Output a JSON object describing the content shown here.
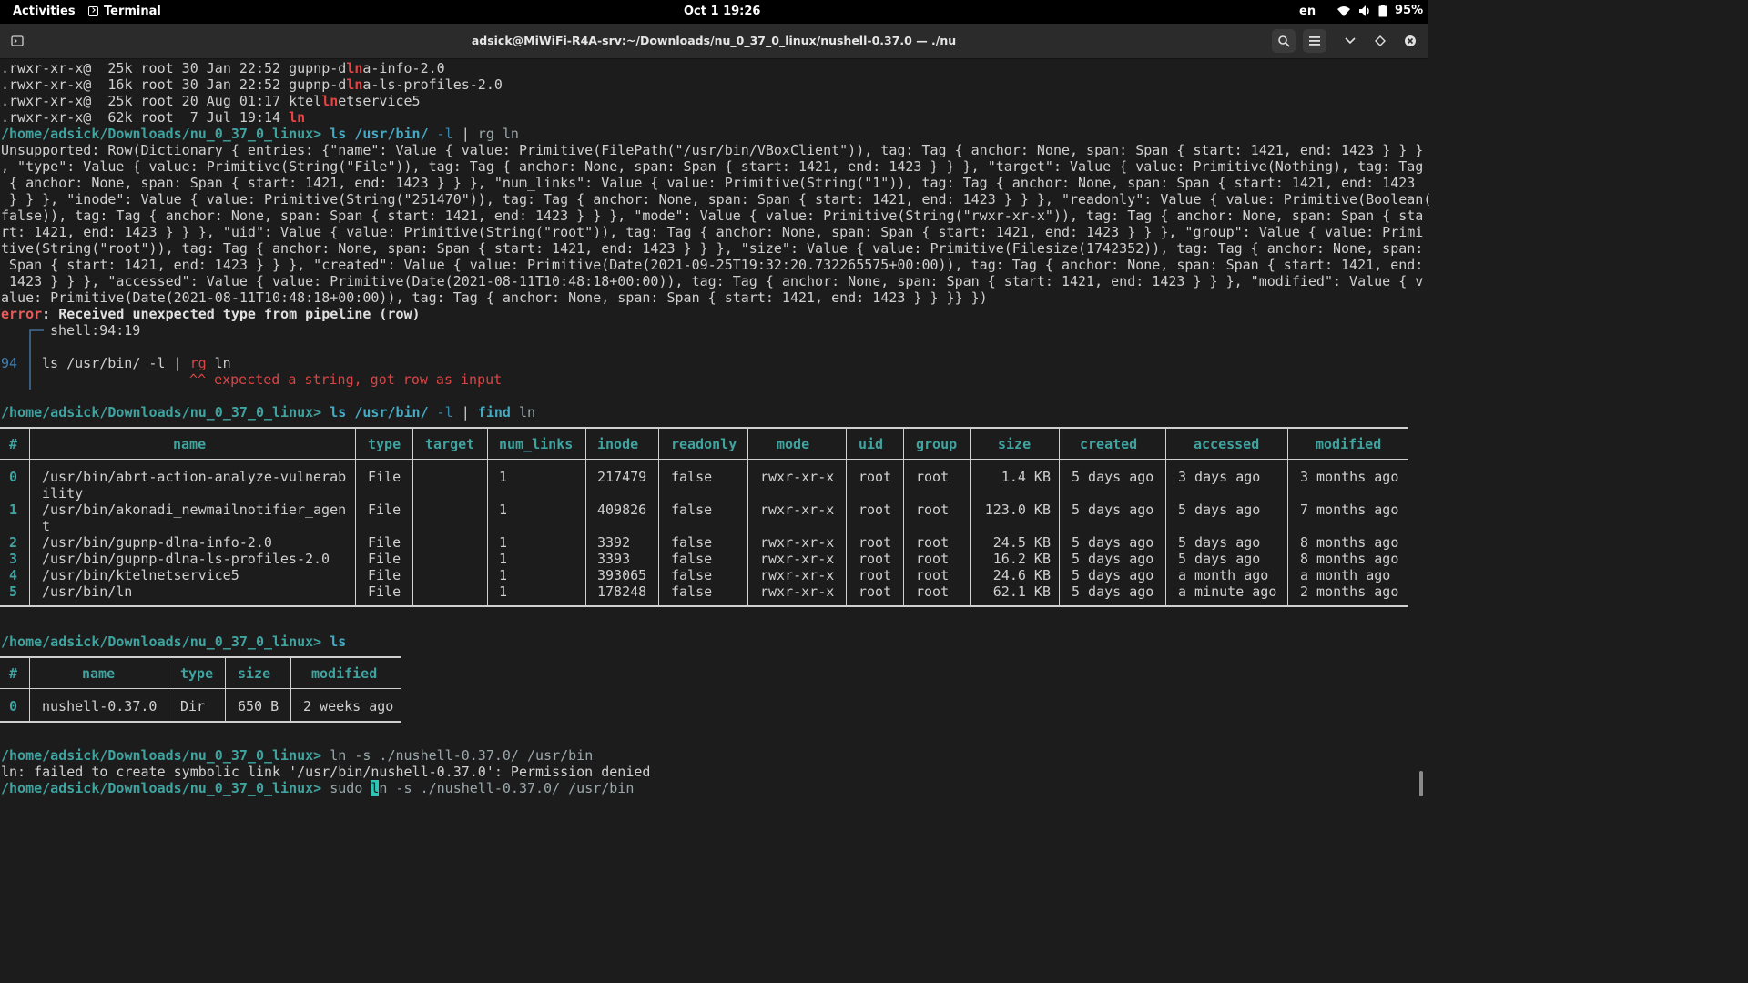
{
  "topbar": {
    "activities": "Activities",
    "app_name": "Terminal",
    "clock": "Oct 1  19:26",
    "lang": "en",
    "battery": "95%"
  },
  "window": {
    "title": "adsick@MiWiFi-R4A-srv:~/Downloads/nu_0_37_0_linux/nushell-0.37.0 — ./nu"
  },
  "terminal": {
    "prompt": "/home/adsick/Downloads/nu_0_37_0_linux>",
    "ls_lines": [
      {
        "perm": ".rwxr-xr-x@",
        "info": "  25k root 30 Jan 22:52 ",
        "pre": "gupnp-d",
        "hl": "ln",
        "post": "a-info-2.0"
      },
      {
        "perm": ".rwxr-xr-x@",
        "info": "  16k root 30 Jan 22:52 ",
        "pre": "gupnp-d",
        "hl": "ln",
        "post": "a-ls-profiles-2.0"
      },
      {
        "perm": ".rwxr-xr-x@",
        "info": "  25k root 20 Aug 01:17 ",
        "pre": "ktel",
        "hl": "ln",
        "post": "etservice5"
      },
      {
        "perm": ".rwxr-xr-x@",
        "info": "  62k root  7 Jul 19:14 ",
        "pre": "",
        "hl": "ln",
        "post": ""
      }
    ],
    "cmd1": {
      "c": "ls",
      "a": "/usr/bin/",
      "f": "-l",
      "p": "|",
      "c2": "rg",
      "a2": "ln"
    },
    "unsupported": [
      "Unsupported: Row(Dictionary { entries: {\"name\": Value { value: Primitive(FilePath(\"/usr/bin/VBoxClient\")), tag: Tag { anchor: None, span: Span { start: 1421, end: 1423 } } }",
      ", \"type\": Value { value: Primitive(String(\"File\")), tag: Tag { anchor: None, span: Span { start: 1421, end: 1423 } } }, \"target\": Value { value: Primitive(Nothing), tag: Tag",
      " { anchor: None, span: Span { start: 1421, end: 1423 } } }, \"num_links\": Value { value: Primitive(String(\"1\")), tag: Tag { anchor: None, span: Span { start: 1421, end: 1423",
      " } } }, \"inode\": Value { value: Primitive(String(\"251470\")), tag: Tag { anchor: None, span: Span { start: 1421, end: 1423 } } }, \"readonly\": Value { value: Primitive(Boolean(",
      "false)), tag: Tag { anchor: None, span: Span { start: 1421, end: 1423 } } }, \"mode\": Value { value: Primitive(String(\"rwxr-xr-x\")), tag: Tag { anchor: None, span: Span { sta",
      "rt: 1421, end: 1423 } } }, \"uid\": Value { value: Primitive(String(\"root\")), tag: Tag { anchor: None, span: Span { start: 1421, end: 1423 } } }, \"group\": Value { value: Primi",
      "tive(String(\"root\")), tag: Tag { anchor: None, span: Span { start: 1421, end: 1423 } } }, \"size\": Value { value: Primitive(Filesize(1742352)), tag: Tag { anchor: None, span:",
      " Span { start: 1421, end: 1423 } } }, \"created\": Value { value: Primitive(Date(2021-09-25T19:32:20.732265575+00:00)), tag: Tag { anchor: None, span: Span { start: 1421, end:",
      " 1423 } } }, \"accessed\": Value { value: Primitive(Date(2021-08-11T10:48:18+00:00)), tag: Tag { anchor: None, span: Span { start: 1421, end: 1423 } } }, \"modified\": Value { v",
      "alue: Primitive(Date(2021-08-11T10:48:18+00:00)), tag: Tag { anchor: None, span: Span { start: 1421, end: 1423 } } }} })"
    ],
    "error": {
      "label": "error",
      "message": ": Received unexpected type from pipeline (row)",
      "location": "shell:94:19",
      "line_no": "94",
      "src_pre": "ls /usr/bin/ -l | ",
      "src_hl": "rg",
      "src_post": " ln",
      "caret": "^^ expected a string, got row as input"
    },
    "cmd2": {
      "c": "ls",
      "a": "/usr/bin/",
      "f": "-l",
      "p": "|",
      "c2": "find",
      "a2": "ln"
    },
    "cmd3": {
      "c": "ls"
    },
    "cmd4": {
      "c": "ln -s ./nushell-0.37.0/ /usr/bin"
    },
    "ln_error": "ln: failed to create symbolic link '/usr/bin/nushell-0.37.0': Permission denied",
    "cmd5": {
      "pre": "sudo ",
      "cursor": "l",
      "post": "n -s ./nushell-0.37.0/ /usr/bin"
    }
  },
  "table1": {
    "headers": [
      "#",
      "name",
      "type",
      "target",
      "num_links",
      "inode",
      "readonly",
      "mode",
      "uid",
      "group",
      "size",
      "created",
      "accessed",
      "modified"
    ],
    "rows": [
      {
        "idx": "0",
        "name": "/usr/bin/abrt-action-analyze-vulnerab",
        "name2": "ility",
        "type": "File",
        "target": "",
        "num_links": "1",
        "inode": "217479",
        "readonly": "false",
        "mode": "rwxr-xr-x",
        "uid": "root",
        "group": "root",
        "size": "1.4 KB",
        "created": "5 days ago",
        "accessed": "3 days ago",
        "modified": "3 months ago"
      },
      {
        "idx": "1",
        "name": "/usr/bin/akonadi_newmailnotifier_agen",
        "name2": "t",
        "type": "File",
        "target": "",
        "num_links": "1",
        "inode": "409826",
        "readonly": "false",
        "mode": "rwxr-xr-x",
        "uid": "root",
        "group": "root",
        "size": "123.0 KB",
        "created": "5 days ago",
        "accessed": "5 days ago",
        "modified": "7 months ago"
      },
      {
        "idx": "2",
        "name": "/usr/bin/gupnp-dlna-info-2.0",
        "name2": "",
        "type": "File",
        "target": "",
        "num_links": "1",
        "inode": "3392",
        "readonly": "false",
        "mode": "rwxr-xr-x",
        "uid": "root",
        "group": "root",
        "size": "24.5 KB",
        "created": "5 days ago",
        "accessed": "5 days ago",
        "modified": "8 months ago"
      },
      {
        "idx": "3",
        "name": "/usr/bin/gupnp-dlna-ls-profiles-2.0",
        "name2": "",
        "type": "File",
        "target": "",
        "num_links": "1",
        "inode": "3393",
        "readonly": "false",
        "mode": "rwxr-xr-x",
        "uid": "root",
        "group": "root",
        "size": "16.2 KB",
        "created": "5 days ago",
        "accessed": "5 days ago",
        "modified": "8 months ago"
      },
      {
        "idx": "4",
        "name": "/usr/bin/ktelnetservice5",
        "name2": "",
        "type": "File",
        "target": "",
        "num_links": "1",
        "inode": "393065",
        "readonly": "false",
        "mode": "rwxr-xr-x",
        "uid": "root",
        "group": "root",
        "size": "24.6 KB",
        "created": "5 days ago",
        "accessed": "a month ago",
        "modified": "a month ago"
      },
      {
        "idx": "5",
        "name": "/usr/bin/ln",
        "name2": "",
        "type": "File",
        "target": "",
        "num_links": "1",
        "inode": "178248",
        "readonly": "false",
        "mode": "rwxr-xr-x",
        "uid": "root",
        "group": "root",
        "size": "62.1 KB",
        "created": "5 days ago",
        "accessed": "a minute ago",
        "modified": "2 months ago"
      }
    ]
  },
  "table2": {
    "headers": [
      "#",
      "name",
      "type",
      "size",
      "modified"
    ],
    "rows": [
      {
        "idx": "0",
        "name": "nushell-0.37.0",
        "type": "Dir",
        "size": "650 B",
        "modified": "2 weeks ago"
      }
    ]
  }
}
